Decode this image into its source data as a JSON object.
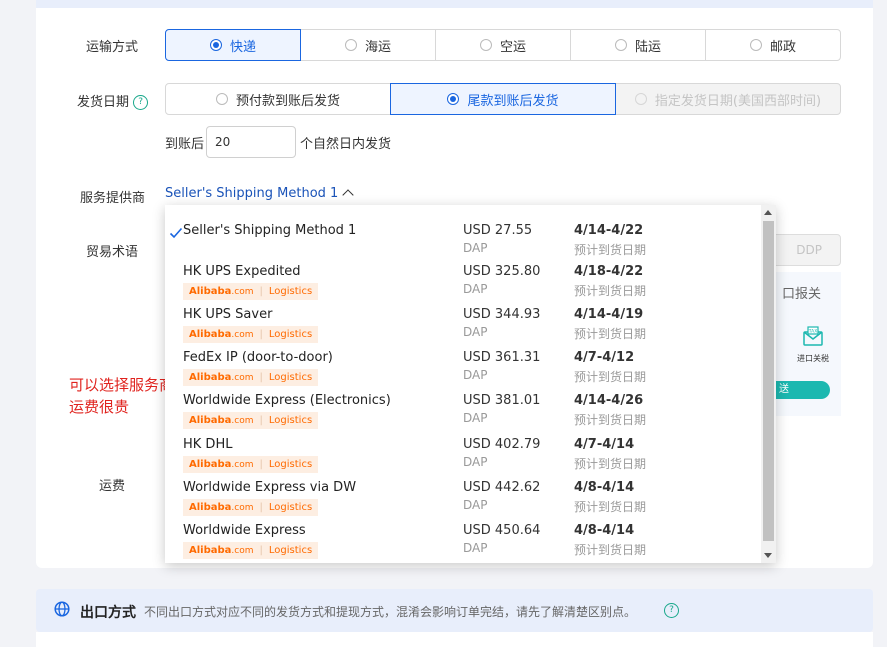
{
  "transport": {
    "label": "运输方式",
    "options": [
      {
        "label": "快递",
        "selected": true
      },
      {
        "label": "海运",
        "selected": false
      },
      {
        "label": "空运",
        "selected": false
      },
      {
        "label": "陆运",
        "selected": false
      },
      {
        "label": "邮政",
        "selected": false
      }
    ]
  },
  "ship_date": {
    "label": "发货日期",
    "help_icon": "?",
    "options": [
      {
        "label": "预付款到账后发货",
        "selected": false,
        "disabled": false
      },
      {
        "label": "尾款到账后发货",
        "selected": true,
        "disabled": false
      },
      {
        "label": "指定发货日期(美国西部时间)",
        "selected": false,
        "disabled": true
      }
    ],
    "after_label": "到账后",
    "days_value": "20",
    "days_suffix": "个自然日内发货"
  },
  "provider": {
    "label": "服务提供商",
    "selected": "Seller's Shipping Method 1"
  },
  "trade_terms": {
    "label": "贸易术语",
    "ddp_option": "DDP",
    "customs_text": "口报关",
    "import_icon_caption": "进口关税",
    "teal_bar_text": "送"
  },
  "freight": {
    "label": "运费"
  },
  "annotation": {
    "line1": "可以选择服务商",
    "line2": "运费很贵"
  },
  "dropdown": {
    "brand": "Alibaba",
    "brand_suffix": ".com",
    "tag_logistics": "Logistics",
    "methods": [
      {
        "name": "Seller's Shipping Method 1",
        "price": "USD 27.55",
        "term": "DAP",
        "dates": "4/14-4/22",
        "date_label": "预计到货日期",
        "checked": true,
        "alibaba": false
      },
      {
        "name": "HK UPS Expedited",
        "price": "USD 325.80",
        "term": "DAP",
        "dates": "4/18-4/22",
        "date_label": "预计到货日期",
        "checked": false,
        "alibaba": true
      },
      {
        "name": "HK UPS Saver",
        "price": "USD 344.93",
        "term": "DAP",
        "dates": "4/14-4/19",
        "date_label": "预计到货日期",
        "checked": false,
        "alibaba": true
      },
      {
        "name": "FedEx IP (door-to-door)",
        "price": "USD 361.31",
        "term": "DAP",
        "dates": "4/7-4/12",
        "date_label": "预计到货日期",
        "checked": false,
        "alibaba": true
      },
      {
        "name": "Worldwide Express (Electronics)",
        "price": "USD 381.01",
        "term": "DAP",
        "dates": "4/14-4/26",
        "date_label": "预计到货日期",
        "checked": false,
        "alibaba": true
      },
      {
        "name": "HK DHL",
        "price": "USD 402.79",
        "term": "DAP",
        "dates": "4/7-4/14",
        "date_label": "预计到货日期",
        "checked": false,
        "alibaba": true
      },
      {
        "name": "Worldwide Express via DW",
        "price": "USD 442.62",
        "term": "DAP",
        "dates": "4/8-4/14",
        "date_label": "预计到货日期",
        "checked": false,
        "alibaba": true
      },
      {
        "name": "Worldwide Express",
        "price": "USD 450.64",
        "term": "DAP",
        "dates": "4/8-4/14",
        "date_label": "预计到货日期",
        "checked": false,
        "alibaba": true
      }
    ]
  },
  "export": {
    "title": "出口方式",
    "description": "不同出口方式对应不同的发货方式和提现方式，混淆会影响订单完结，请先了解清楚区别点。",
    "help_icon": "?"
  },
  "colors": {
    "primary": "#1a66e0",
    "link": "#1a53b8",
    "alibaba_orange": "#ff6a00",
    "annotation_red": "#e0241f",
    "teal": "#1cb8b0"
  },
  "icons": {
    "radio": "radio-icon",
    "help": "question-circle-icon",
    "chevron": "chevron-up-icon",
    "check": "check-icon",
    "globe": "globe-icon",
    "import_duty": "envelope-tax-icon"
  }
}
